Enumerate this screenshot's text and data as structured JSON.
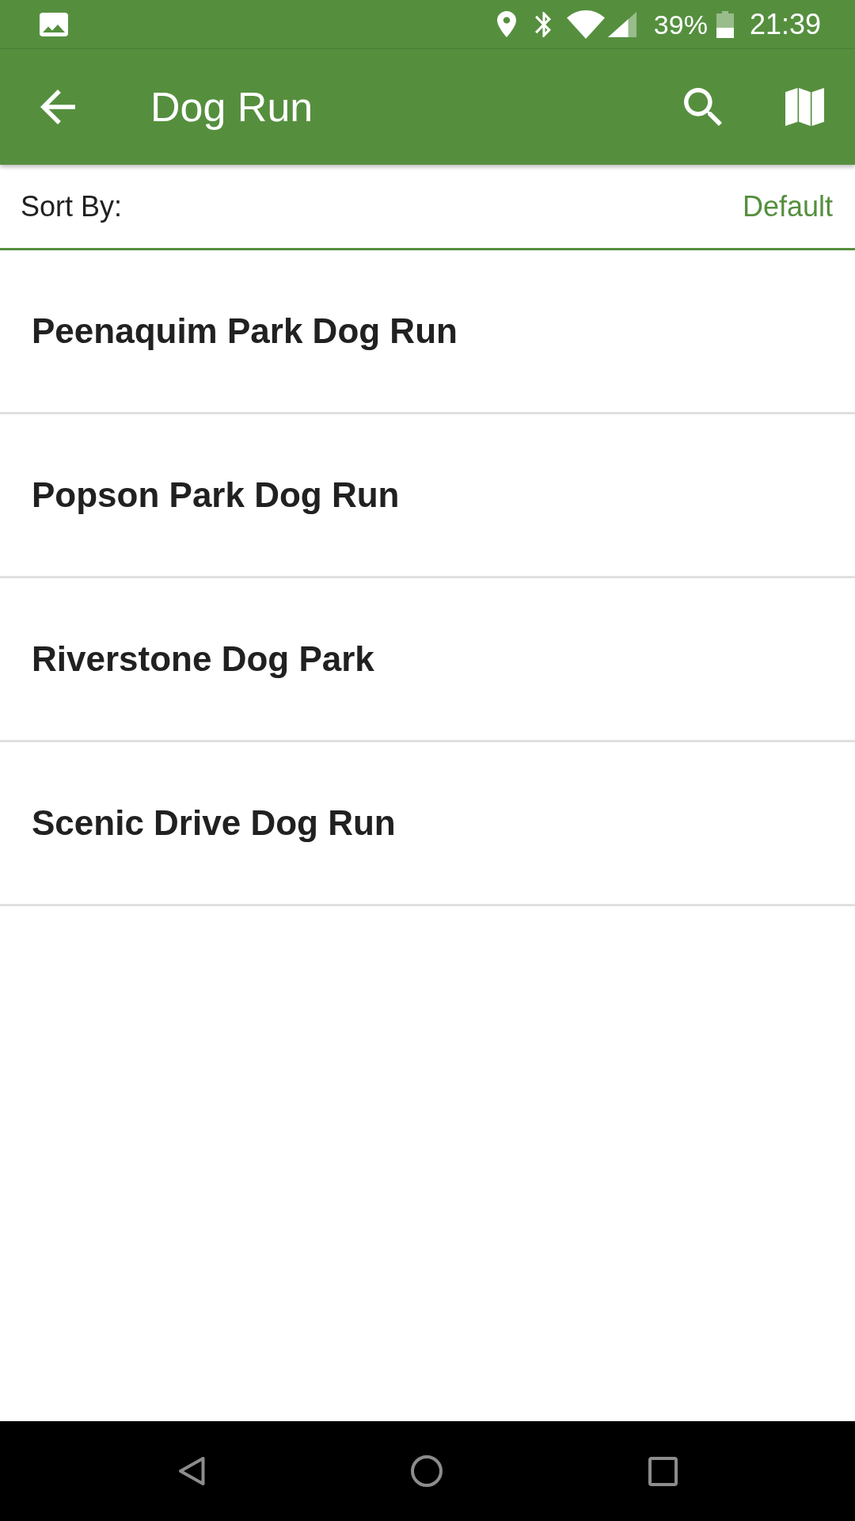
{
  "status_bar": {
    "battery_percent": "39%",
    "time": "21:39"
  },
  "app_bar": {
    "title": "Dog Run"
  },
  "sort": {
    "label": "Sort By:",
    "value": "Default"
  },
  "list": {
    "items": [
      {
        "title": "Peenaquim Park Dog Run"
      },
      {
        "title": "Popson Park Dog Run"
      },
      {
        "title": "Riverstone Dog Park"
      },
      {
        "title": "Scenic Drive Dog Run"
      }
    ]
  }
}
